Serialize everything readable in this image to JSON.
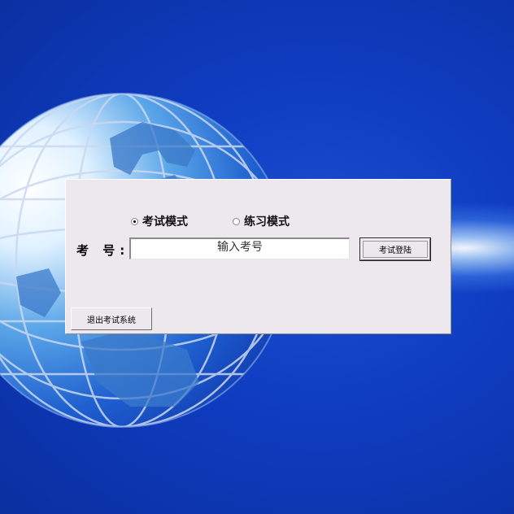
{
  "mode": {
    "exam_label": "考试模式",
    "practice_label": "练习模式",
    "selected": "exam"
  },
  "exam_id": {
    "label": "考 号:",
    "value": "输入考号"
  },
  "buttons": {
    "login_label": "考试登陆",
    "exit_label": "退出考试系统"
  },
  "colors": {
    "background": "#0f3cc0",
    "dialog": "#ede8ee"
  }
}
